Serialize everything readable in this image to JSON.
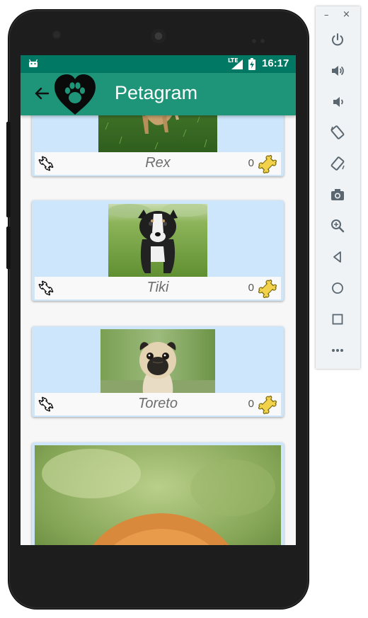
{
  "status_bar": {
    "network": "LTE",
    "time": "16:17",
    "icons": [
      "android-icon",
      "lte-icon",
      "signal-icon",
      "battery-charging-icon"
    ]
  },
  "app_bar": {
    "title": "Petagram",
    "back_icon": "arrow-back-icon",
    "logo_icon": "heart-paw-icon",
    "colors": {
      "status": "#007863",
      "toolbar": "#1e9479",
      "card": "#cde6fb"
    }
  },
  "pets": [
    {
      "name": "Rex",
      "likes": "0",
      "photo": "dog-on-grass"
    },
    {
      "name": "Tiki",
      "likes": "0",
      "photo": "puppy-on-grass"
    },
    {
      "name": "Toreto",
      "likes": "0",
      "photo": "pug"
    },
    {
      "name": "",
      "likes": "",
      "photo": "golden-retriever"
    }
  ],
  "emulator_panel": {
    "window_controls": [
      "minimize-icon",
      "close-icon"
    ],
    "minimize_glyph": "–",
    "close_glyph": "×",
    "buttons": [
      "power-icon",
      "volume-up-icon",
      "volume-down-icon",
      "rotate-left-icon",
      "rotate-right-icon",
      "camera-icon",
      "zoom-icon",
      "back-icon",
      "home-icon",
      "overview-icon",
      "more-icon"
    ]
  }
}
